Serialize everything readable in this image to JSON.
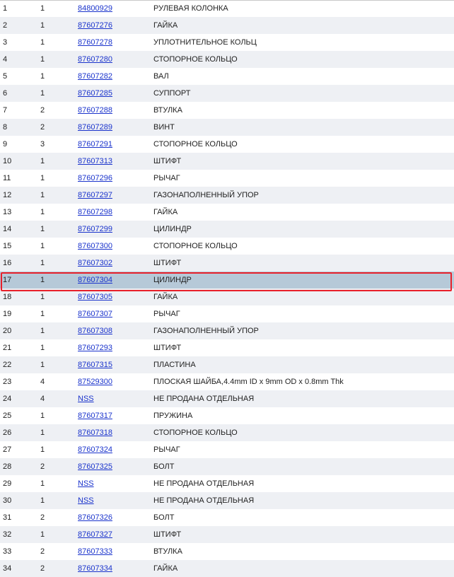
{
  "rows": [
    {
      "pos": "1",
      "qty": "1",
      "number": "84800929",
      "name": "РУЛЕВАЯ КОЛОНКА"
    },
    {
      "pos": "2",
      "qty": "1",
      "number": "87607276",
      "name": "ГАЙКА"
    },
    {
      "pos": "3",
      "qty": "1",
      "number": "87607278",
      "name": "УПЛОТНИТЕЛЬНОЕ КОЛЬЦ"
    },
    {
      "pos": "4",
      "qty": "1",
      "number": "87607280",
      "name": "СТОПОРНОЕ КОЛЬЦО"
    },
    {
      "pos": "5",
      "qty": "1",
      "number": "87607282",
      "name": "ВАЛ"
    },
    {
      "pos": "6",
      "qty": "1",
      "number": "87607285",
      "name": "СУППОРТ"
    },
    {
      "pos": "7",
      "qty": "2",
      "number": "87607288",
      "name": "ВТУЛКА"
    },
    {
      "pos": "8",
      "qty": "2",
      "number": "87607289",
      "name": "ВИНТ"
    },
    {
      "pos": "9",
      "qty": "3",
      "number": "87607291",
      "name": "СТОПОРНОЕ КОЛЬЦО"
    },
    {
      "pos": "10",
      "qty": "1",
      "number": "87607313",
      "name": "ШТИФТ"
    },
    {
      "pos": "11",
      "qty": "1",
      "number": "87607296",
      "name": "РЫЧАГ"
    },
    {
      "pos": "12",
      "qty": "1",
      "number": "87607297",
      "name": "ГАЗОНАПОЛНЕННЫЙ УПОР"
    },
    {
      "pos": "13",
      "qty": "1",
      "number": "87607298",
      "name": "ГАЙКА"
    },
    {
      "pos": "14",
      "qty": "1",
      "number": "87607299",
      "name": "ЦИЛИНДР"
    },
    {
      "pos": "15",
      "qty": "1",
      "number": "87607300",
      "name": "СТОПОРНОЕ КОЛЬЦО"
    },
    {
      "pos": "16",
      "qty": "1",
      "number": "87607302",
      "name": "ШТИФТ"
    },
    {
      "pos": "17",
      "qty": "1",
      "number": "87607304",
      "name": "ЦИЛИНДР"
    },
    {
      "pos": "18",
      "qty": "1",
      "number": "87607305",
      "name": "ГАЙКА"
    },
    {
      "pos": "19",
      "qty": "1",
      "number": "87607307",
      "name": "РЫЧАГ"
    },
    {
      "pos": "20",
      "qty": "1",
      "number": "87607308",
      "name": "ГАЗОНАПОЛНЕННЫЙ УПОР"
    },
    {
      "pos": "21",
      "qty": "1",
      "number": "87607293",
      "name": "ШТИФТ"
    },
    {
      "pos": "22",
      "qty": "1",
      "number": "87607315",
      "name": "ПЛАСТИНА"
    },
    {
      "pos": "23",
      "qty": "4",
      "number": "87529300",
      "name": "ПЛОСКАЯ ШАЙБА,4.4mm ID x 9mm OD x 0.8mm Thk"
    },
    {
      "pos": "24",
      "qty": "4",
      "number": "NSS",
      "name": "НЕ ПРОДАНА ОТДЕЛЬНАЯ"
    },
    {
      "pos": "25",
      "qty": "1",
      "number": "87607317",
      "name": "ПРУЖИНА"
    },
    {
      "pos": "26",
      "qty": "1",
      "number": "87607318",
      "name": "СТОПОРНОЕ КОЛЬЦО"
    },
    {
      "pos": "27",
      "qty": "1",
      "number": "87607324",
      "name": "РЫЧАГ"
    },
    {
      "pos": "28",
      "qty": "2",
      "number": "87607325",
      "name": "БОЛТ"
    },
    {
      "pos": "29",
      "qty": "1",
      "number": "NSS",
      "name": "НЕ ПРОДАНА ОТДЕЛЬНАЯ"
    },
    {
      "pos": "30",
      "qty": "1",
      "number": "NSS",
      "name": "НЕ ПРОДАНА ОТДЕЛЬНАЯ"
    },
    {
      "pos": "31",
      "qty": "2",
      "number": "87607326",
      "name": "БОЛТ"
    },
    {
      "pos": "32",
      "qty": "1",
      "number": "87607327",
      "name": "ШТИФТ"
    },
    {
      "pos": "33",
      "qty": "2",
      "number": "87607333",
      "name": "ВТУЛКА"
    },
    {
      "pos": "34",
      "qty": "2",
      "number": "87607334",
      "name": "ГАЙКА"
    }
  ],
  "selected_pos": "17",
  "colors": {
    "row_even": "#eef0f4",
    "row_selected": "#b6c9d8",
    "highlight_border": "#e8202a",
    "link": "#1a33cc"
  }
}
